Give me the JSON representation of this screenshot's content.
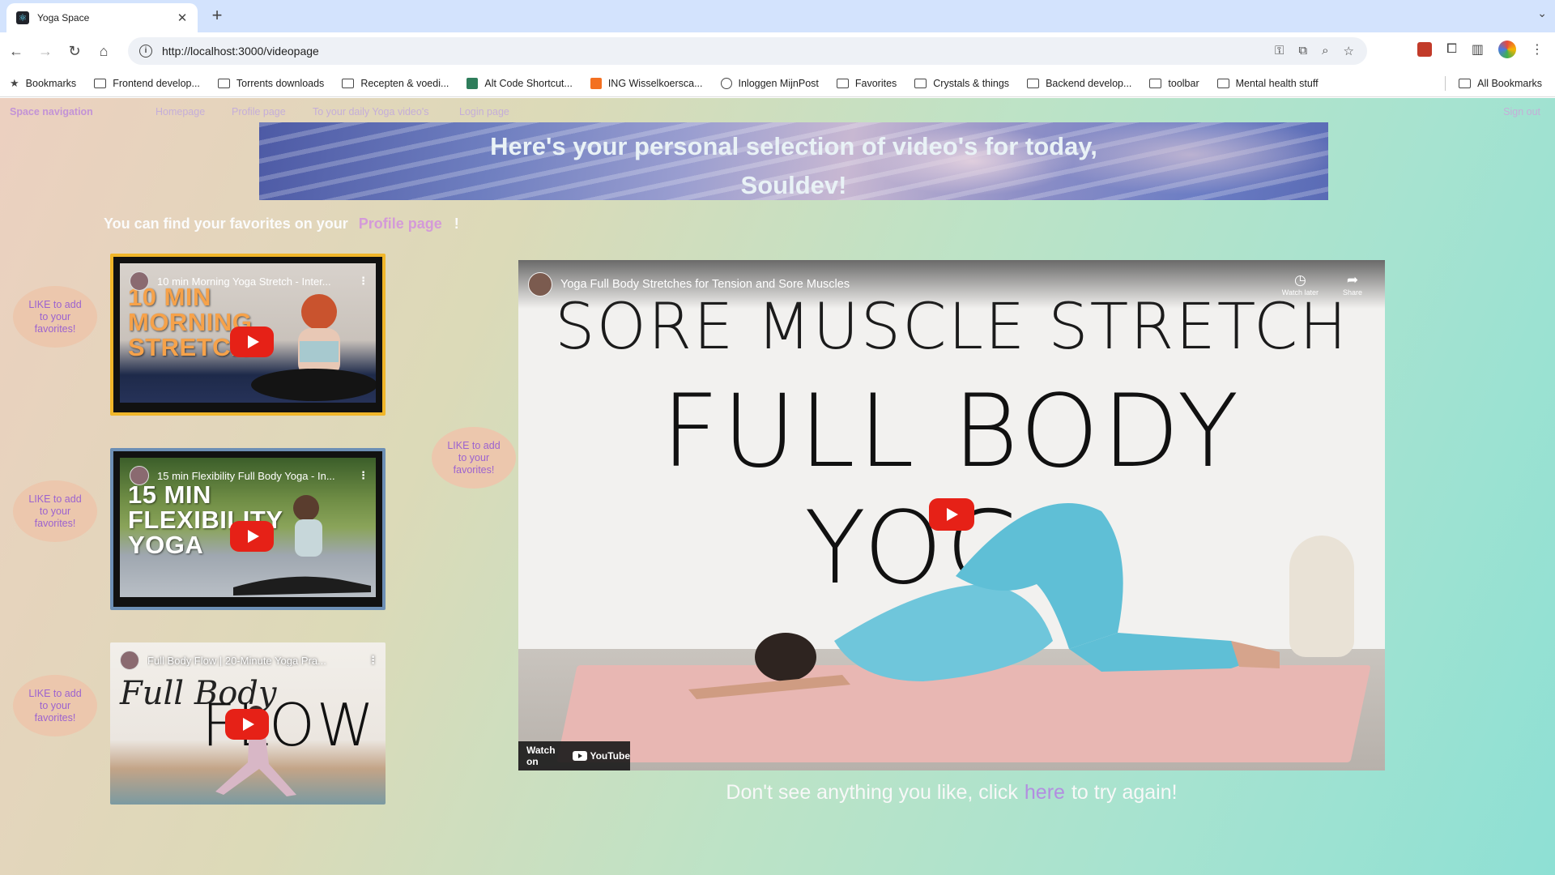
{
  "browser": {
    "tab_title": "Yoga Space",
    "url": "http://localhost:3000/videopage",
    "bookmarks": [
      {
        "label": "Bookmarks",
        "icon": "star-icon"
      },
      {
        "label": "Frontend develop...",
        "icon": "folder-icon"
      },
      {
        "label": "Torrents downloads",
        "icon": "folder-icon"
      },
      {
        "label": "Recepten & voedi...",
        "icon": "folder-icon"
      },
      {
        "label": "Alt Code Shortcut...",
        "icon": "site-icon"
      },
      {
        "label": "ING Wisselkoersca...",
        "icon": "site-icon"
      },
      {
        "label": "Inloggen MijnPost",
        "icon": "globe-icon"
      },
      {
        "label": "Favorites",
        "icon": "folder-icon"
      },
      {
        "label": "Crystals & things",
        "icon": "folder-icon"
      },
      {
        "label": "Backend develop...",
        "icon": "folder-icon"
      },
      {
        "label": "toolbar",
        "icon": "folder-icon"
      },
      {
        "label": "Mental health stuff",
        "icon": "folder-icon"
      }
    ],
    "all_bookmarks": "All Bookmarks"
  },
  "nav": {
    "brand": "Space navigation",
    "links": [
      "Homepage",
      "Profile page",
      "To your daily Yoga video's",
      "Login page"
    ],
    "signout": "Sign out"
  },
  "banner": {
    "line1": "Here's your personal selection of video's for today,",
    "line2": "Souldev!"
  },
  "favorites_note": {
    "before": "You can find your favorites on your",
    "link": "Profile page",
    "after": "!"
  },
  "like_label": "LIKE to add to your favorites!",
  "videos": [
    {
      "title": "10 min Morning Yoga Stretch - Inter...",
      "caption_lines": [
        "10 MIN",
        "MORNING",
        "STRETCH"
      ]
    },
    {
      "title": "15 min Flexibility Full Body Yoga - In...",
      "caption_lines": [
        "15 MIN",
        "FLEXIBILITY",
        "YOGA"
      ]
    },
    {
      "title": "Full Body Flow | 20-Minute Yoga Pra...",
      "caption_script": "Full Body",
      "caption_big": "FLOW"
    }
  ],
  "main_video": {
    "title": "Yoga Full Body Stretches for Tension and Sore Muscles",
    "line1": "SORE MUSCLE STRETCH",
    "line2": "FULL BODY YOGA",
    "watch_later": "Watch later",
    "share": "Share",
    "watch_on": "Watch on",
    "youtube": "YouTube"
  },
  "retry": {
    "before": "Don't see anything you like, click",
    "link": "here",
    "after": "to try again!"
  },
  "colors": {
    "accent_purple": "#b28ee0",
    "like_bg": "#ecc7ad",
    "youtube_red": "#e62117"
  }
}
